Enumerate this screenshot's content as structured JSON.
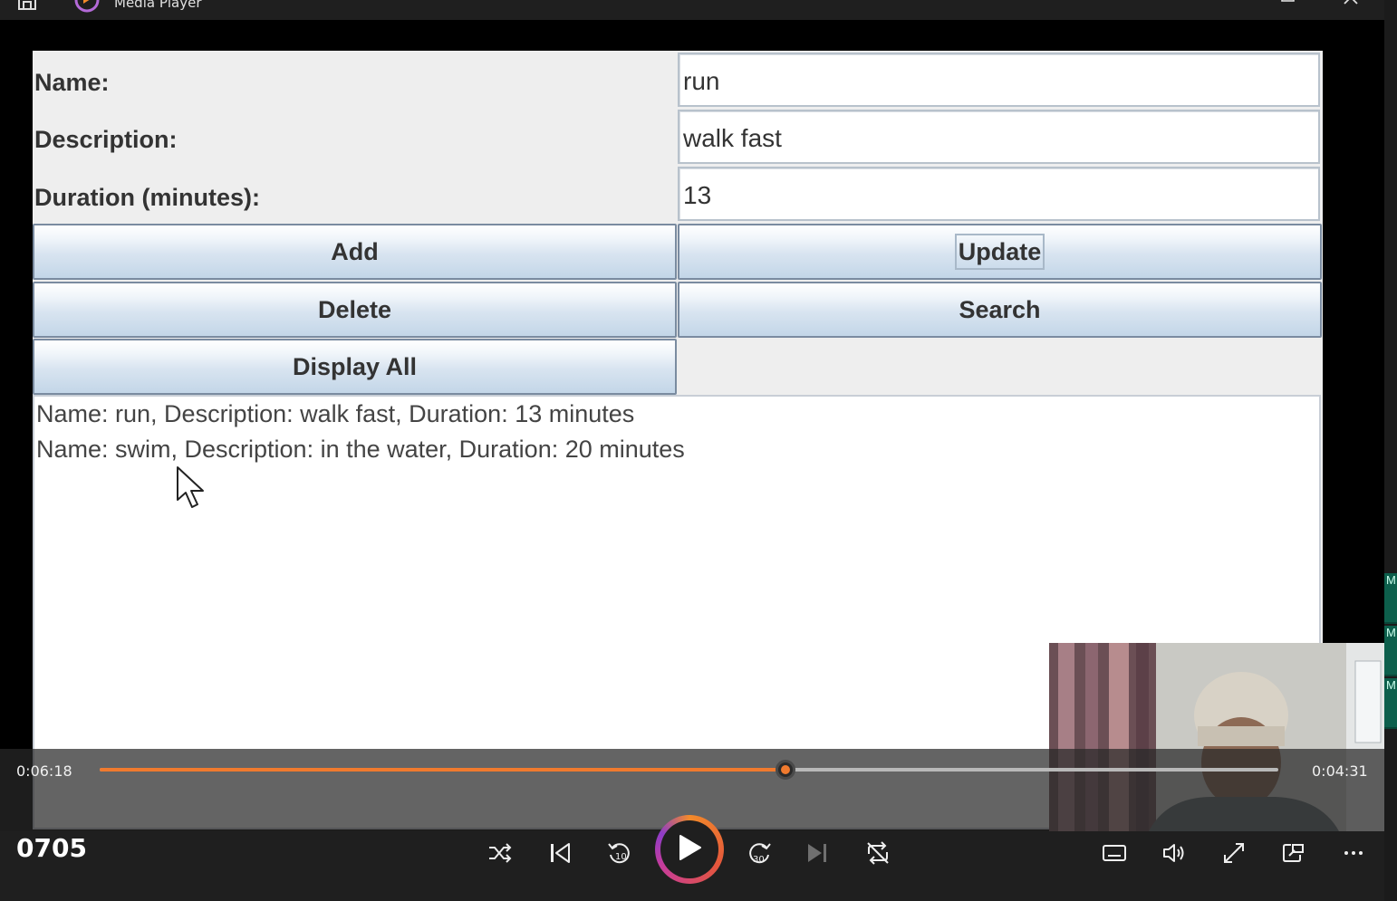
{
  "window": {
    "title": "Media Player"
  },
  "form": {
    "name_label": "Name:",
    "description_label": "Description:",
    "duration_label": "Duration (minutes):",
    "name_value": "run",
    "description_value": "walk fast",
    "duration_value": "13",
    "buttons": {
      "add": "Add",
      "update": "Update",
      "delete": "Delete",
      "search": "Search",
      "display_all": "Display All"
    },
    "output_lines": [
      "Name: run, Description: walk fast, Duration: 13 minutes",
      "Name: swim, Description: in the water, Duration: 20 minutes"
    ]
  },
  "player": {
    "current_time": "0:06:18",
    "remaining_time": "0:04:31",
    "progress_fraction": 0.582,
    "media_title": "0705",
    "accent_color": "#f07a2e",
    "controls": [
      "shuffle-icon",
      "previous-icon",
      "rewind-10-icon",
      "play-icon",
      "forward-30-icon",
      "next-icon",
      "repeat-off-icon",
      "subtitles-icon",
      "volume-icon",
      "fullscreen-icon",
      "mini-player-icon",
      "more-icon"
    ]
  },
  "desktop_edge": {
    "tiles": [
      "M",
      "M",
      "M"
    ]
  }
}
